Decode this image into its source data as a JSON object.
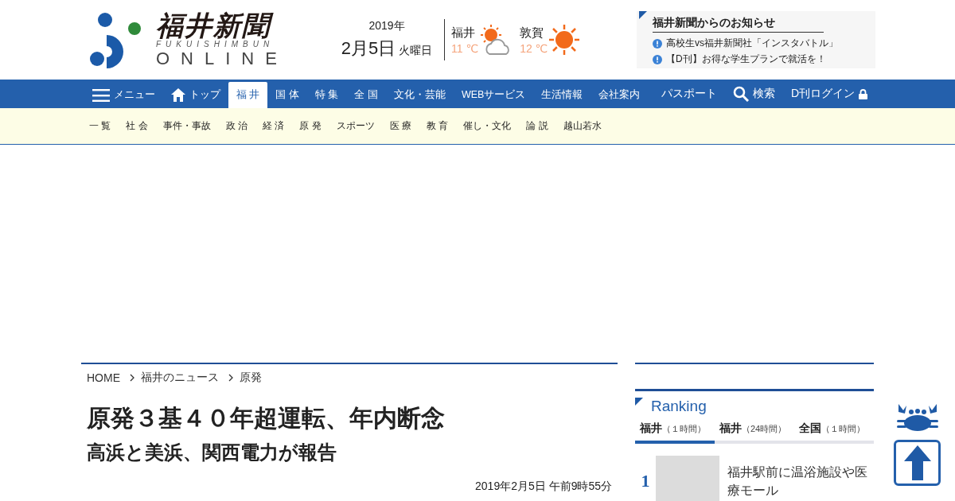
{
  "logo": {
    "name": "福井新聞",
    "romaji": "FUKUISHIMBUN",
    "online": "ONLINE"
  },
  "date": {
    "year": "2019年",
    "day": "2月5日",
    "weekday": "火曜日"
  },
  "weather": [
    {
      "city": "福井",
      "temp": "11 ℃",
      "kind": "sun_cloud"
    },
    {
      "city": "敦賀",
      "temp": "12 ℃",
      "kind": "sun"
    }
  ],
  "notice": {
    "title": "福井新聞からのお知らせ",
    "items": [
      "高校生vs福井新聞社「インスタバトル」",
      "【D刊】お得な学生プランで就活を！"
    ]
  },
  "nav": [
    {
      "label": "メニュー",
      "kind": "menu",
      "selected": false
    },
    {
      "label": "トップ",
      "kind": "home",
      "selected": false
    },
    {
      "label": "福 井",
      "kind": "plain",
      "selected": true
    },
    {
      "label": "国 体",
      "kind": "plain",
      "selected": false
    },
    {
      "label": "特 集",
      "kind": "plain",
      "selected": false
    },
    {
      "label": "全 国",
      "kind": "plain",
      "selected": false
    },
    {
      "label": "文化・芸能",
      "kind": "plain",
      "selected": false
    },
    {
      "label": "WEBサービス",
      "kind": "plain",
      "selected": false
    },
    {
      "label": "生活情報",
      "kind": "plain",
      "selected": false
    },
    {
      "label": "会社案内",
      "kind": "plain",
      "selected": false
    }
  ],
  "nav_right": [
    {
      "label": "パスポート",
      "kind": "plain"
    },
    {
      "label": "検索",
      "kind": "search"
    },
    {
      "label": "D刊ログイン",
      "kind": "lock"
    }
  ],
  "subnav": [
    "一 覧",
    "社 会",
    "事件・事故",
    "政 治",
    "経 済",
    "原 発",
    "スポーツ",
    "医 療",
    "教 育",
    "催し・文化",
    "論 説",
    "越山若水"
  ],
  "breadcrumb": [
    "HOME",
    "福井のニュース",
    "原発"
  ],
  "article": {
    "title": "原発３基４０年超運転、年内断念",
    "subtitle": "高浜と美浜、関西電力が報告",
    "datetime": "2019年2月5日 午前9時55分"
  },
  "ranking": {
    "title": "Ranking",
    "tabs": [
      {
        "label": "福井",
        "period": "（１時間）",
        "selected": true
      },
      {
        "label": "福井",
        "period": "（24時間）",
        "selected": false
      },
      {
        "label": "全国",
        "period": "（１時間）",
        "selected": false
      }
    ],
    "items": [
      {
        "rank": "1",
        "title": "福井駅前に温浴施設や医療モール"
      }
    ]
  }
}
